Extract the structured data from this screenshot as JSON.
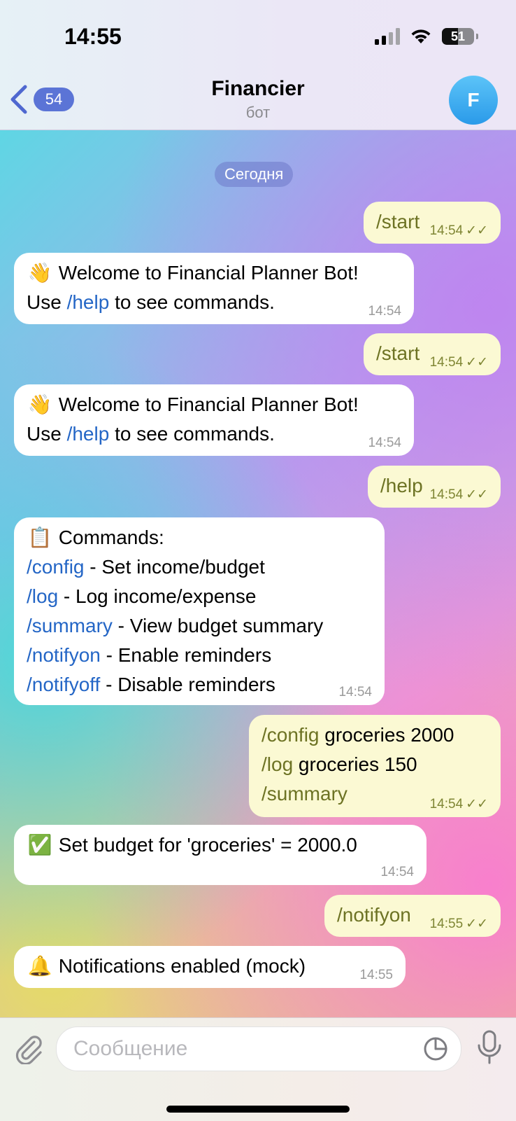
{
  "status_bar": {
    "time": "14:55",
    "battery": "51"
  },
  "header": {
    "back_count": "54",
    "title": "Financier",
    "subtitle": "бот",
    "avatar_letter": "F"
  },
  "chat": {
    "date_label": "Сегодня",
    "messages": [
      {
        "dir": "out",
        "text": "/start",
        "time": "14:54"
      },
      {
        "dir": "in",
        "emoji": "👋",
        "line1": "Welcome to Financial Planner Bot!",
        "line2_pre": "Use ",
        "line2_cmd": "/help",
        "line2_post": " to see commands.",
        "time": "14:54"
      },
      {
        "dir": "out",
        "text": "/start",
        "time": "14:54"
      },
      {
        "dir": "in",
        "emoji": "👋",
        "line1": "Welcome to Financial Planner Bot!",
        "line2_pre": "Use ",
        "line2_cmd": "/help",
        "line2_post": " to see commands.",
        "time": "14:54"
      },
      {
        "dir": "out",
        "text": "/help",
        "time": "14:54"
      },
      {
        "dir": "in",
        "emoji": "📋",
        "title": "Commands:",
        "commands": [
          {
            "cmd": "/config",
            "desc": " - Set income/budget"
          },
          {
            "cmd": "/log",
            "desc": " - Log income/expense"
          },
          {
            "cmd": "/summary",
            "desc": " - View budget summary"
          },
          {
            "cmd": "/notifyon",
            "desc": " - Enable reminders"
          },
          {
            "cmd": "/notifyoff",
            "desc": " - Disable reminders"
          }
        ],
        "time": "14:54"
      },
      {
        "dir": "out",
        "lines": [
          {
            "cmd": "/config",
            "rest": " groceries 2000"
          },
          {
            "cmd": "/log",
            "rest": " groceries 150"
          },
          {
            "cmd": "/summary",
            "rest": ""
          }
        ],
        "time": "14:54"
      },
      {
        "dir": "in",
        "emoji": "✅",
        "text": "Set budget for 'groceries' = 2000.0",
        "time": "14:54"
      },
      {
        "dir": "out",
        "text": "/notifyon",
        "time": "14:55"
      },
      {
        "dir": "in",
        "emoji": "🔔",
        "text": "Notifications enabled (mock)",
        "time": "14:55"
      }
    ]
  },
  "input": {
    "placeholder": "Сообщение"
  }
}
